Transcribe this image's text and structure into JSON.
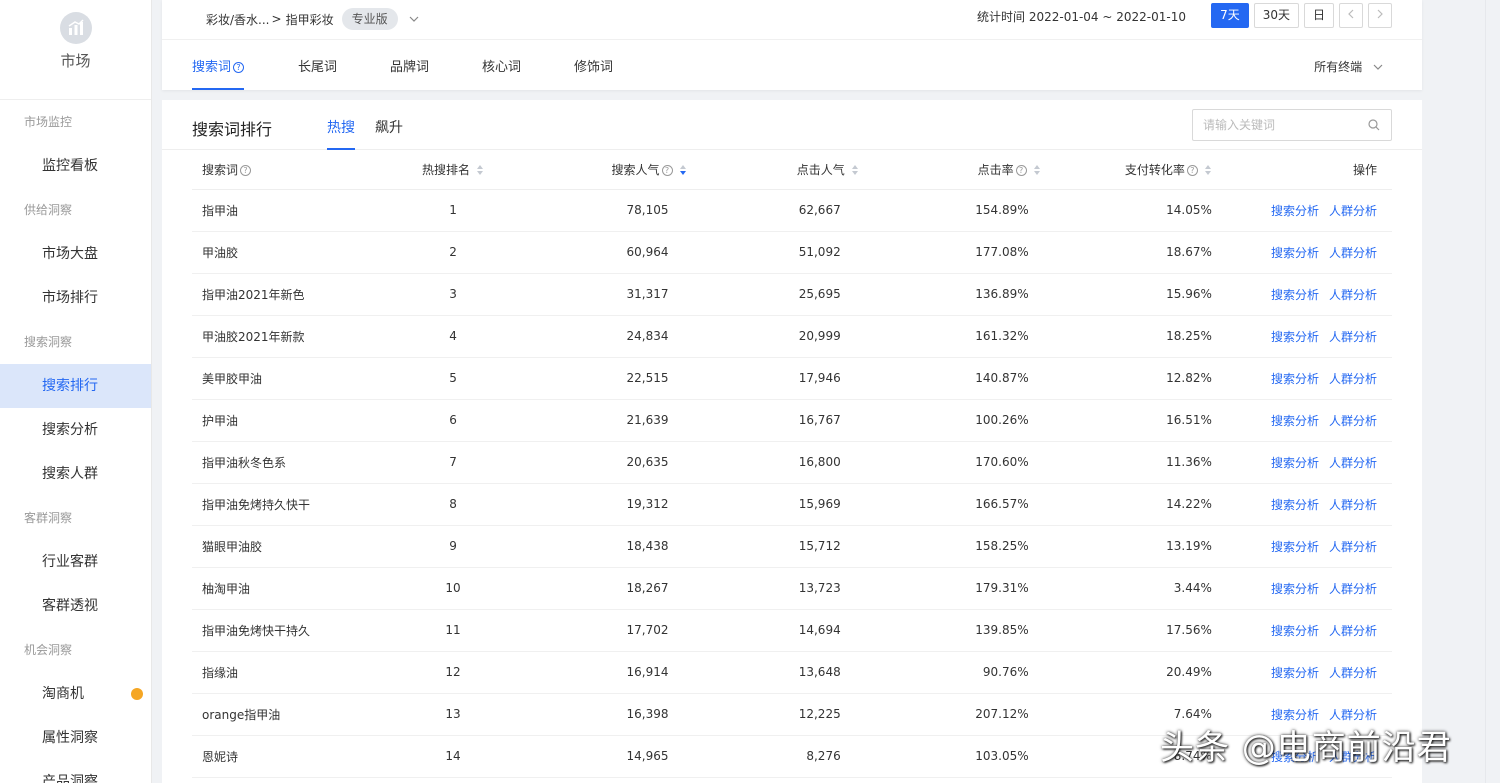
{
  "sidebar": {
    "title": "市场",
    "groups": [
      {
        "label": "市场监控",
        "items": [
          {
            "label": "监控看板"
          }
        ]
      },
      {
        "label": "供给洞察",
        "items": [
          {
            "label": "市场大盘"
          },
          {
            "label": "市场排行"
          }
        ]
      },
      {
        "label": "搜索洞察",
        "items": [
          {
            "label": "搜索排行",
            "active": true
          },
          {
            "label": "搜索分析"
          },
          {
            "label": "搜索人群"
          }
        ]
      },
      {
        "label": "客群洞察",
        "items": [
          {
            "label": "行业客群"
          },
          {
            "label": "客群透视"
          }
        ]
      },
      {
        "label": "机会洞察",
        "items": [
          {
            "label": "淘商机",
            "dot": true
          },
          {
            "label": "属性洞察"
          },
          {
            "label": "产品洞察"
          }
        ]
      }
    ]
  },
  "topbar": {
    "breadcrumb_path": "彩妆/香水...",
    "breadcrumb_sep": ">",
    "breadcrumb_current": "指甲彩妆",
    "edition_badge": "专业版",
    "date_label": "统计时间 2022-01-04 ~ 2022-01-10",
    "date_buttons": [
      "7天",
      "30天",
      "日"
    ],
    "active_date": "7天"
  },
  "word_tabs": [
    {
      "label": "搜索词",
      "active": true,
      "help": true
    },
    {
      "label": "长尾词"
    },
    {
      "label": "品牌词"
    },
    {
      "label": "核心词"
    },
    {
      "label": "修饰词"
    }
  ],
  "terminal_select": "所有终端",
  "ranking": {
    "title": "搜索词排行",
    "sub_tabs": [
      {
        "label": "热搜",
        "active": true
      },
      {
        "label": "飙升"
      }
    ],
    "search_placeholder": "请输入关键词",
    "columns": [
      "搜索词",
      "热搜排名",
      "搜索人气",
      "点击人气",
      "点击率",
      "支付转化率",
      "操作"
    ],
    "action_labels": [
      "搜索分析",
      "人群分析"
    ],
    "rows": [
      {
        "keyword": "指甲油",
        "rank": "1",
        "search_pop": "78,105",
        "click_pop": "62,667",
        "ctr": "154.89%",
        "cvr": "14.05%"
      },
      {
        "keyword": "甲油胶",
        "rank": "2",
        "search_pop": "60,964",
        "click_pop": "51,092",
        "ctr": "177.08%",
        "cvr": "18.67%"
      },
      {
        "keyword": "指甲油2021年新色",
        "rank": "3",
        "search_pop": "31,317",
        "click_pop": "25,695",
        "ctr": "136.89%",
        "cvr": "15.96%"
      },
      {
        "keyword": "甲油胶2021年新款",
        "rank": "4",
        "search_pop": "24,834",
        "click_pop": "20,999",
        "ctr": "161.32%",
        "cvr": "18.25%"
      },
      {
        "keyword": "美甲胶甲油",
        "rank": "5",
        "search_pop": "22,515",
        "click_pop": "17,946",
        "ctr": "140.87%",
        "cvr": "12.82%"
      },
      {
        "keyword": "护甲油",
        "rank": "6",
        "search_pop": "21,639",
        "click_pop": "16,767",
        "ctr": "100.26%",
        "cvr": "16.51%"
      },
      {
        "keyword": "指甲油秋冬色系",
        "rank": "7",
        "search_pop": "20,635",
        "click_pop": "16,800",
        "ctr": "170.60%",
        "cvr": "11.36%"
      },
      {
        "keyword": "指甲油免烤持久快干",
        "rank": "8",
        "search_pop": "19,312",
        "click_pop": "15,969",
        "ctr": "166.57%",
        "cvr": "14.22%"
      },
      {
        "keyword": "猫眼甲油胶",
        "rank": "9",
        "search_pop": "18,438",
        "click_pop": "15,712",
        "ctr": "158.25%",
        "cvr": "13.19%"
      },
      {
        "keyword": "柚淘甲油",
        "rank": "10",
        "search_pop": "18,267",
        "click_pop": "13,723",
        "ctr": "179.31%",
        "cvr": "3.44%"
      },
      {
        "keyword": "指甲油免烤快干持久",
        "rank": "11",
        "search_pop": "17,702",
        "click_pop": "14,694",
        "ctr": "139.85%",
        "cvr": "17.56%"
      },
      {
        "keyword": "指缘油",
        "rank": "12",
        "search_pop": "16,914",
        "click_pop": "13,648",
        "ctr": "90.76%",
        "cvr": "20.49%"
      },
      {
        "keyword": "orange指甲油",
        "rank": "13",
        "search_pop": "16,398",
        "click_pop": "12,225",
        "ctr": "207.12%",
        "cvr": "7.64%"
      },
      {
        "keyword": "恩妮诗",
        "rank": "14",
        "search_pop": "14,965",
        "click_pop": "8,276",
        "ctr": "103.05%",
        "cvr": "8.74%"
      }
    ]
  },
  "watermark": "头条 @电商前沿君",
  "colors": {
    "accent": "#2468f2",
    "active_bg": "#dbe6fa",
    "dot": "#f5a623"
  }
}
